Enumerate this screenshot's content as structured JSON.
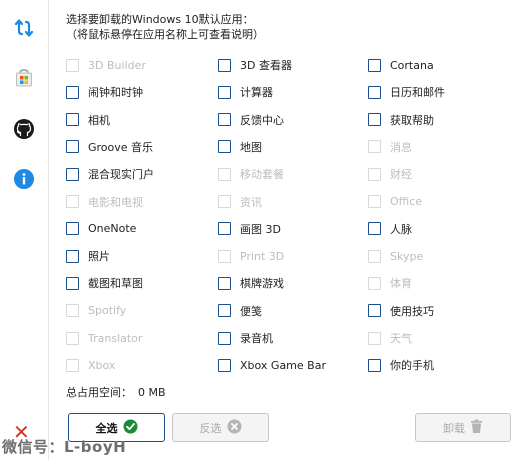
{
  "header": {
    "line1": "选择要卸载的Windows 10默认应用：",
    "line2": "（将鼠标悬停在应用名称上可查看说明）"
  },
  "apps": [
    {
      "label": "3D Builder",
      "enabled": false,
      "checked": false
    },
    {
      "label": "3D 查看器",
      "enabled": true,
      "checked": false
    },
    {
      "label": "Cortana",
      "enabled": true,
      "checked": false
    },
    {
      "label": "闹钟和时钟",
      "enabled": true,
      "checked": false
    },
    {
      "label": "计算器",
      "enabled": true,
      "checked": false
    },
    {
      "label": "日历和邮件",
      "enabled": true,
      "checked": false
    },
    {
      "label": "相机",
      "enabled": true,
      "checked": false
    },
    {
      "label": "反馈中心",
      "enabled": true,
      "checked": false
    },
    {
      "label": "获取帮助",
      "enabled": true,
      "checked": false
    },
    {
      "label": "Groove 音乐",
      "enabled": true,
      "checked": false
    },
    {
      "label": "地图",
      "enabled": true,
      "checked": false
    },
    {
      "label": "消息",
      "enabled": false,
      "checked": false
    },
    {
      "label": "混合现实门户",
      "enabled": true,
      "checked": false
    },
    {
      "label": "移动套餐",
      "enabled": false,
      "checked": false
    },
    {
      "label": "财经",
      "enabled": false,
      "checked": false
    },
    {
      "label": "电影和电视",
      "enabled": false,
      "checked": false
    },
    {
      "label": "资讯",
      "enabled": false,
      "checked": false
    },
    {
      "label": "Office",
      "enabled": false,
      "checked": false
    },
    {
      "label": "OneNote",
      "enabled": true,
      "checked": false
    },
    {
      "label": "画图 3D",
      "enabled": true,
      "checked": false
    },
    {
      "label": "人脉",
      "enabled": true,
      "checked": false
    },
    {
      "label": "照片",
      "enabled": true,
      "checked": false
    },
    {
      "label": "Print 3D",
      "enabled": false,
      "checked": false
    },
    {
      "label": "Skype",
      "enabled": false,
      "checked": false
    },
    {
      "label": "截图和草图",
      "enabled": true,
      "checked": false
    },
    {
      "label": "棋牌游戏",
      "enabled": true,
      "checked": false
    },
    {
      "label": "体育",
      "enabled": false,
      "checked": false
    },
    {
      "label": "Spotify",
      "enabled": false,
      "checked": false
    },
    {
      "label": "便笺",
      "enabled": true,
      "checked": false
    },
    {
      "label": "使用技巧",
      "enabled": true,
      "checked": false
    },
    {
      "label": "Translator",
      "enabled": false,
      "checked": false
    },
    {
      "label": "录音机",
      "enabled": true,
      "checked": false
    },
    {
      "label": "天气",
      "enabled": false,
      "checked": false
    },
    {
      "label": "Xbox",
      "enabled": false,
      "checked": false
    },
    {
      "label": "Xbox Game Bar",
      "enabled": true,
      "checked": false
    },
    {
      "label": "你的手机",
      "enabled": true,
      "checked": false
    }
  ],
  "summary": {
    "label": "总占用空间：",
    "value": "0 MB"
  },
  "buttons": {
    "select_all": "全选",
    "invert": "反选",
    "uninstall": "卸载"
  },
  "sidebar": {
    "icons": [
      "refresh-icon",
      "store-icon",
      "github-icon",
      "info-icon"
    ]
  },
  "watermark": "微信号：L-boyH",
  "colors": {
    "accent": "#1a4f8f",
    "disabled_text": "#bdbdbd",
    "info_blue": "#1e88e5"
  }
}
